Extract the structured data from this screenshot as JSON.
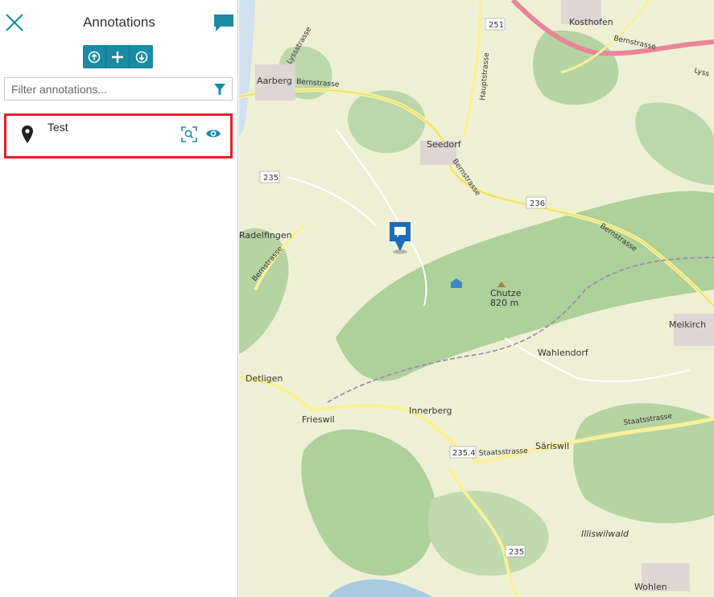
{
  "panel": {
    "title": "Annotations",
    "close_icon": "close-icon",
    "comment_icon": "comment-icon",
    "toolbar": [
      "arrow-up-circle-icon",
      "plus-icon",
      "arrow-down-circle-icon"
    ],
    "filter": {
      "placeholder": "Filter annotations...",
      "value": "",
      "icon": "filter-icon"
    },
    "annotations": [
      {
        "label": "Test",
        "icon": "map-pin-icon",
        "actions": [
          "zoom-to-icon",
          "eye-icon"
        ]
      }
    ],
    "accent": "#1a8ba3",
    "highlight": "#e5202b"
  },
  "map": {
    "places": {
      "aarberg": "Aarberg",
      "kosthofen": "Kosthofen",
      "seedorf": "Seedorf",
      "radelfingen": "Radelfingen",
      "chutze": "Chutze",
      "chutze_elev": "820 m",
      "meikirch": "Meikirch",
      "wahlendorf": "Wahlendorf",
      "detligen": "Detligen",
      "frieswil": "Frieswil",
      "innerberg": "Innerberg",
      "sariswil": "Säriswil",
      "illiswilwald": "Illiswilwald",
      "wohlen": "Wohlen"
    },
    "roads": {
      "bern1": "Bernstrasse",
      "bern2": "Bernstrasse",
      "bern3": "Bernstrasse",
      "bern4": "Bernstrasse",
      "bern5": "Bernstrasse",
      "lyss1": "Lyssstrasse",
      "lyss2": "Lyss",
      "haupt": "Hauptstrasse",
      "staats1": "Staatsstrasse",
      "staats2": "Staatsstrasse"
    },
    "shields": {
      "s251": "251",
      "s235a": "235",
      "s236": "236",
      "s2354": "235.4",
      "s235b": "235"
    },
    "marker_icon": "comment-marker-icon"
  }
}
